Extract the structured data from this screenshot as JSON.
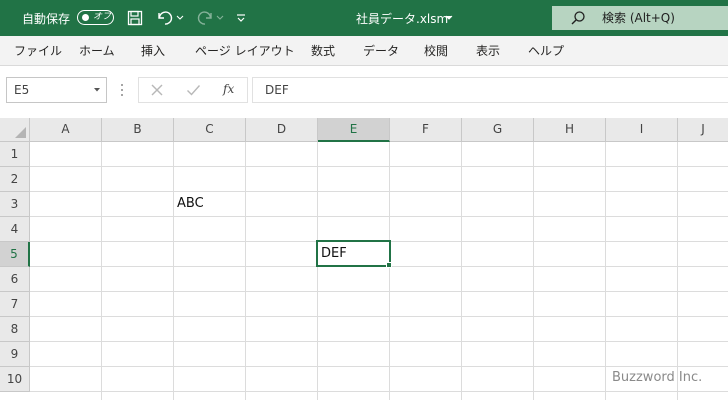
{
  "titlebar": {
    "autosave_label": "自動保存",
    "autosave_state": "オフ",
    "document_title": "社員データ.xlsm",
    "search_text": "検索 (Alt+Q)",
    "bg_color": "#217346"
  },
  "ribbon_tabs": [
    "ファイル",
    "ホーム",
    "挿入",
    "ページ レイアウト",
    "数式",
    "データ",
    "校閲",
    "表示",
    "ヘルプ"
  ],
  "formula_bar": {
    "name_box": "E5",
    "fx_label": "fx",
    "formula": "DEF"
  },
  "sheet": {
    "columns": [
      "A",
      "B",
      "C",
      "D",
      "E",
      "F",
      "G",
      "H",
      "I",
      "J"
    ],
    "rows": [
      "1",
      "2",
      "3",
      "4",
      "5",
      "6",
      "7",
      "8",
      "9",
      "10"
    ],
    "selected_column": "E",
    "selected_row": "5",
    "cells": {
      "C3": "ABC",
      "E5": "DEF"
    },
    "accent_color": "#217346"
  },
  "watermark": "Buzzword Inc."
}
